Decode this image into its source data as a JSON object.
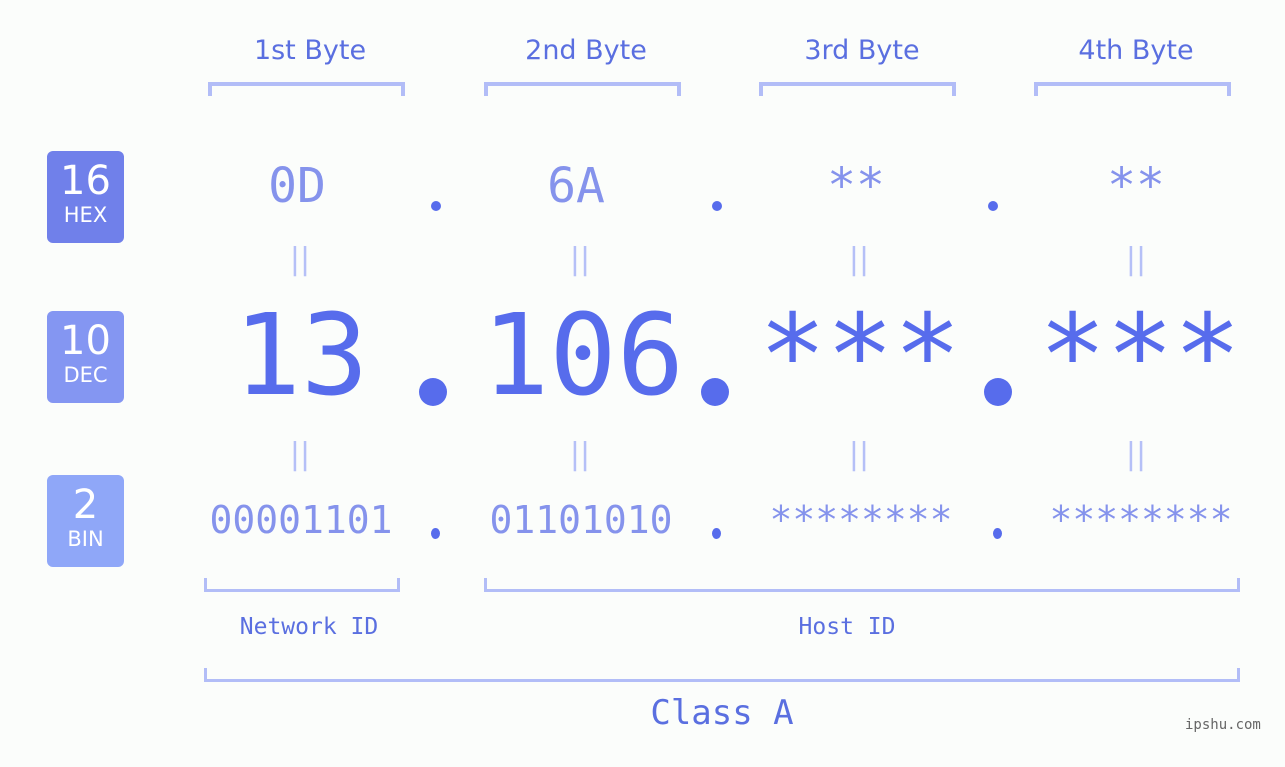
{
  "headers": [
    "1st Byte",
    "2nd Byte",
    "3rd Byte",
    "4th Byte"
  ],
  "badges": {
    "hex": {
      "num": "16",
      "label": "HEX",
      "color": "#7080ea"
    },
    "dec": {
      "num": "10",
      "label": "DEC",
      "color": "#8496f2"
    },
    "bin": {
      "num": "2",
      "label": "BIN",
      "color": "#8fa7f8"
    }
  },
  "hex": [
    "0D",
    "6A",
    "**",
    "**"
  ],
  "dec": [
    "13",
    "106",
    "***",
    "***"
  ],
  "bin": [
    "00001101",
    "01101010",
    "********",
    "********"
  ],
  "equals_glyph": "||",
  "network_id_label": "Network ID",
  "host_id_label": "Host ID",
  "class_label": "Class A",
  "watermark": "ipshu.com",
  "colors": {
    "accent": "#576cec",
    "light_accent": "#8593ec",
    "bracket": "#b2bdf7",
    "background": "#fbfdfb"
  }
}
